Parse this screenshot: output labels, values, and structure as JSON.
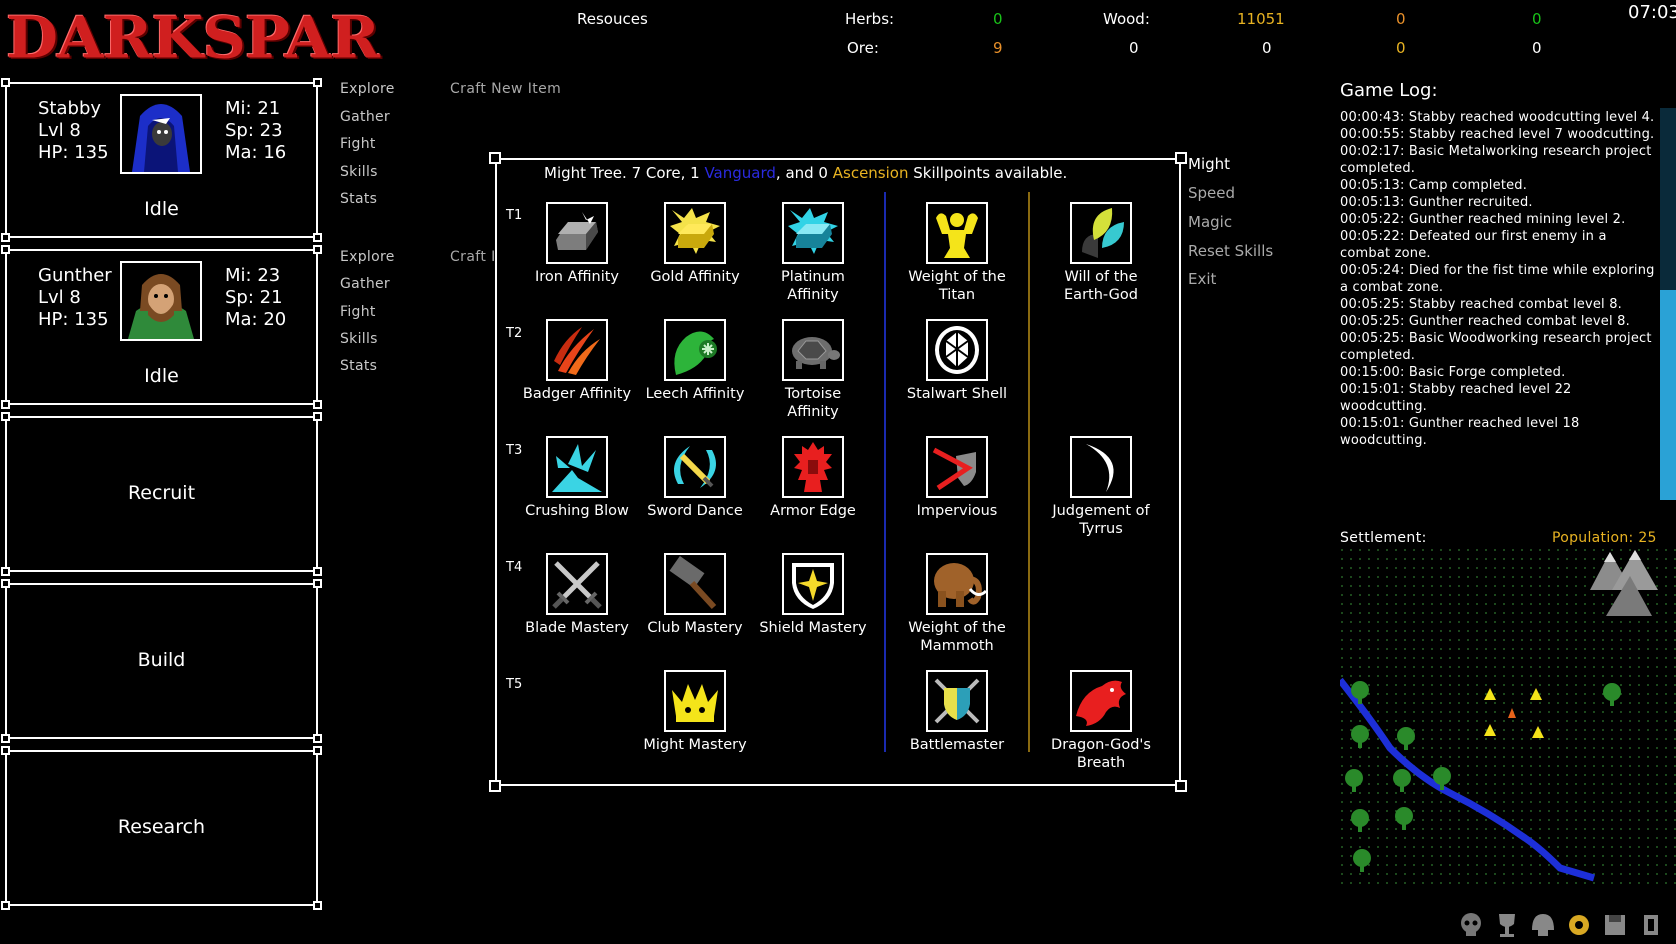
{
  "logo": "DARKSPAR",
  "clock": "07:03",
  "resources": {
    "title": "Resouces",
    "herbs_label": "Herbs:",
    "ore_label": "Ore:",
    "wood_label": "Wood:",
    "row1": {
      "herbs": "0",
      "wood": "11051",
      "extra1": "0",
      "extra2": "0"
    },
    "row2": {
      "ore": "9",
      "c2": "0",
      "c3": "0",
      "c4": "0",
      "c5": "0"
    },
    "colors": {
      "green": "#19c219",
      "orange": "#e8902a",
      "yellow": "#e8b322"
    }
  },
  "heroes": [
    {
      "name": "Stabby",
      "level": "Lvl 8",
      "hp": "HP: 135",
      "mi": "Mi: 21",
      "sp": "Sp: 23",
      "ma": "Ma: 16",
      "status": "Idle",
      "menu": [
        "Explore",
        "Gather",
        "Fight",
        "Skills",
        "Stats"
      ],
      "craft": "Craft New Item"
    },
    {
      "name": "Gunther",
      "level": "Lvl 8",
      "hp": "HP: 135",
      "mi": "Mi: 23",
      "sp": "Sp: 21",
      "ma": "Ma: 20",
      "status": "Idle",
      "menu": [
        "Explore",
        "Gather",
        "Fight",
        "Skills",
        "Stats"
      ],
      "craft": "Craft I"
    }
  ],
  "panels": {
    "recruit": "Recruit",
    "build": "Build",
    "research": "Research"
  },
  "tree": {
    "header_pre": "Might Tree. 7 Core, 1 ",
    "vanguard": "Vanguard",
    "header_mid": ", and 0 ",
    "ascension": "Ascension",
    "header_post": " Skillpoints available.",
    "tiers": [
      "T1",
      "T2",
      "T3",
      "T4",
      "T5"
    ],
    "skills": {
      "iron_affinity": "Iron Affinity",
      "gold_affinity": "Gold Affinity",
      "platinum_affinity": "Platinum Affinity",
      "weight_titan": "Weight of the Titan",
      "will_earth_god": "Will of the Earth-God",
      "badger_affinity": "Badger Affinity",
      "leech_affinity": "Leech Affinity",
      "tortoise_affinity": "Tortoise Affinity",
      "stalwart_shell": "Stalwart Shell",
      "crushing_blow": "Crushing Blow",
      "sword_dance": "Sword Dance",
      "armor_edge": "Armor Edge",
      "impervious": "Impervious",
      "judgement_tyrrus": "Judgement of Tyrrus",
      "blade_mastery": "Blade Mastery",
      "club_mastery": "Club Mastery",
      "shield_mastery": "Shield Mastery",
      "weight_mammoth": "Weight of the Mammoth",
      "might_mastery": "Might Mastery",
      "battlemaster": "Battlemaster",
      "dragon_breath": "Dragon-God's Breath"
    },
    "menu": [
      "Might",
      "Speed",
      "Magic",
      "Reset Skills",
      "Exit"
    ]
  },
  "log": {
    "title": "Game Log:",
    "entries": [
      "00:00:43: Stabby reached woodcutting level 4.",
      "00:00:55: Stabby reached level 7 woodcutting.",
      "00:02:17: Basic Metalworking research project completed.",
      "00:05:13: Camp completed.",
      "00:05:13: Gunther recruited.",
      "00:05:22: Gunther reached mining level 2.",
      "00:05:22: Defeated our first enemy in a combat zone.",
      "00:05:24: Died for the fist time while exploring a combat zone.",
      "00:05:25: Stabby reached combat level 8.",
      "00:05:25: Gunther reached combat level 8.",
      "00:05:25: Basic Woodworking research project completed.",
      "00:15:00: Basic Forge completed.",
      "00:15:01: Stabby reached level 22 woodcutting.",
      "00:15:01: Gunther reached level 18 woodcutting."
    ]
  },
  "settlement": {
    "label": "Settlement:",
    "population": "Population: 25"
  },
  "toolbar_icons": [
    "skull-icon",
    "trophy-icon",
    "helmet-icon",
    "gear-icon",
    "save-icon",
    "exit-icon"
  ]
}
